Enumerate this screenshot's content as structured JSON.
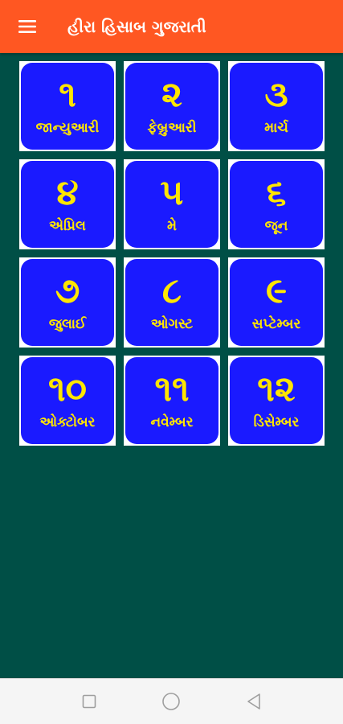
{
  "app_bar": {
    "title": "હીરા હિસાબ ગુજરાતી",
    "menu_icon": "hamburger-menu-icon",
    "background_color": "#ff5722"
  },
  "background_color": "#004f46",
  "tile_color": "#1a1aff",
  "tile_text_color": "#ffe600",
  "months": [
    {
      "number": "૧",
      "label": "જાન્યુઆરી"
    },
    {
      "number": "૨",
      "label": "ફેબ્રુઆરી"
    },
    {
      "number": "૩",
      "label": "માર્ચ"
    },
    {
      "number": "૪",
      "label": "એપ્રિલ"
    },
    {
      "number": "૫",
      "label": "મે"
    },
    {
      "number": "૬",
      "label": "જૂન"
    },
    {
      "number": "૭",
      "label": "જુલાઈ"
    },
    {
      "number": "૮",
      "label": "ઓગસ્ટ"
    },
    {
      "number": "૯",
      "label": "સપ્ટેમ્બર"
    },
    {
      "number": "૧૦",
      "label": "ઓક્ટોબર"
    },
    {
      "number": "૧૧",
      "label": "નવેમ્બર"
    },
    {
      "number": "૧૨",
      "label": "ડિસેમ્બર"
    }
  ],
  "nav_bar": {
    "buttons": [
      "recent-apps-icon",
      "home-icon",
      "back-icon"
    ]
  }
}
